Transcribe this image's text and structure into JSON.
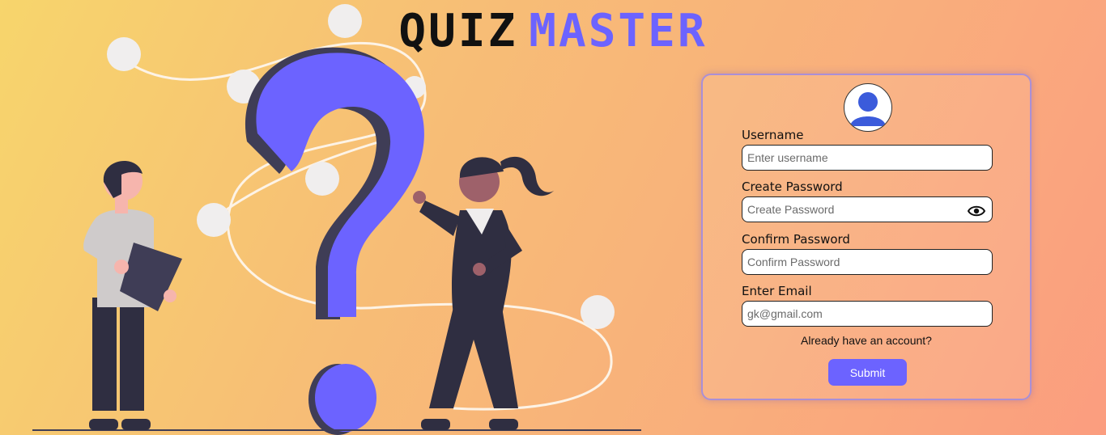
{
  "brand": {
    "word1": "QUIZ",
    "word2": "MASTER"
  },
  "form": {
    "username": {
      "label": "Username",
      "placeholder": "Enter username"
    },
    "create_password": {
      "label": "Create Password",
      "placeholder": "Create Password"
    },
    "confirm_password": {
      "label": "Confirm Password",
      "placeholder": "Confirm Password"
    },
    "email": {
      "label": "Enter Email",
      "placeholder": "gk@gmail.com"
    },
    "login_link": "Already have an account?",
    "submit_label": "Submit"
  },
  "icons": {
    "avatar": "user-avatar-icon",
    "eye": "eye-icon"
  },
  "colors": {
    "accent": "#6c63ff",
    "dark": "#2f2e41",
    "background_start": "#f7d56c",
    "background_end": "#fb9d7f"
  }
}
